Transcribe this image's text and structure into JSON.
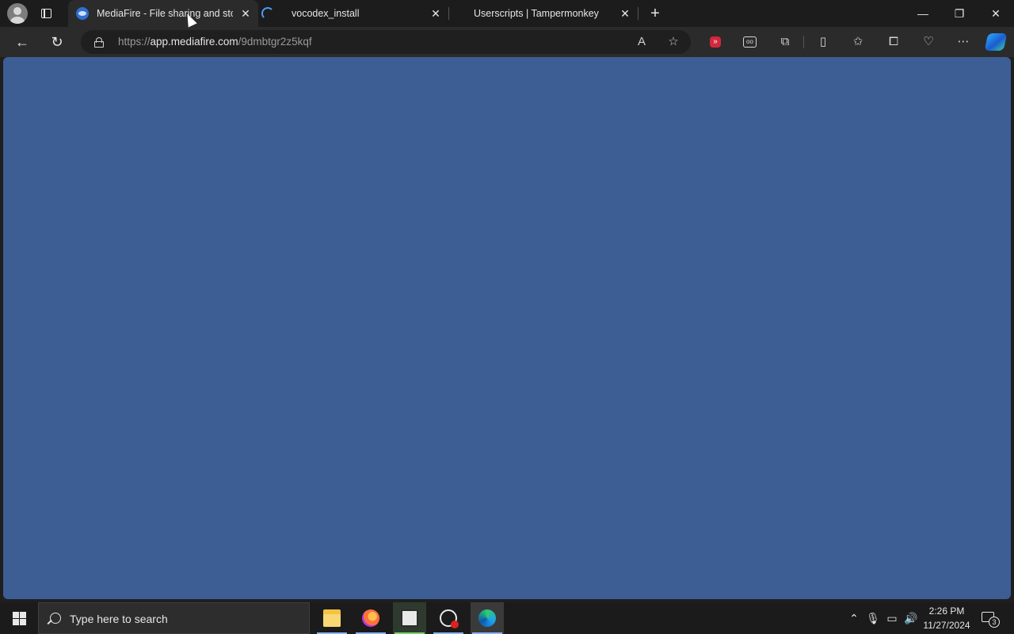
{
  "browser": {
    "tabs": [
      {
        "title": "MediaFire - File sharing and stora",
        "favicon": "mediafire-icon",
        "active": true
      },
      {
        "title": "vocodex_install",
        "favicon": "loading-spinner-icon",
        "active": false
      },
      {
        "title": "Userscripts | Tampermonkey",
        "favicon": "none",
        "active": false
      }
    ],
    "close_glyph": "✕",
    "new_tab_glyph": "+",
    "window_controls": {
      "minimize": "—",
      "restore": "❐",
      "close": "✕"
    },
    "address": {
      "scheme": "https://",
      "host": "app.mediafire.com",
      "path": "/9dmbtgr2z5kqf"
    }
  },
  "content": {
    "background_color": "#3d5e94"
  },
  "taskbar": {
    "search_placeholder": "Type here to search",
    "apps": [
      "file-explorer-icon",
      "firefox-icon",
      "video-editor-icon",
      "obs-icon",
      "edge-icon"
    ],
    "clock": {
      "time": "2:26 PM",
      "date": "11/27/2024"
    },
    "notification_count": "3"
  },
  "colors": {
    "accent": "#8ab4f8",
    "chrome_dark": "#1c1c1c",
    "page_blue": "#3d5e94"
  }
}
